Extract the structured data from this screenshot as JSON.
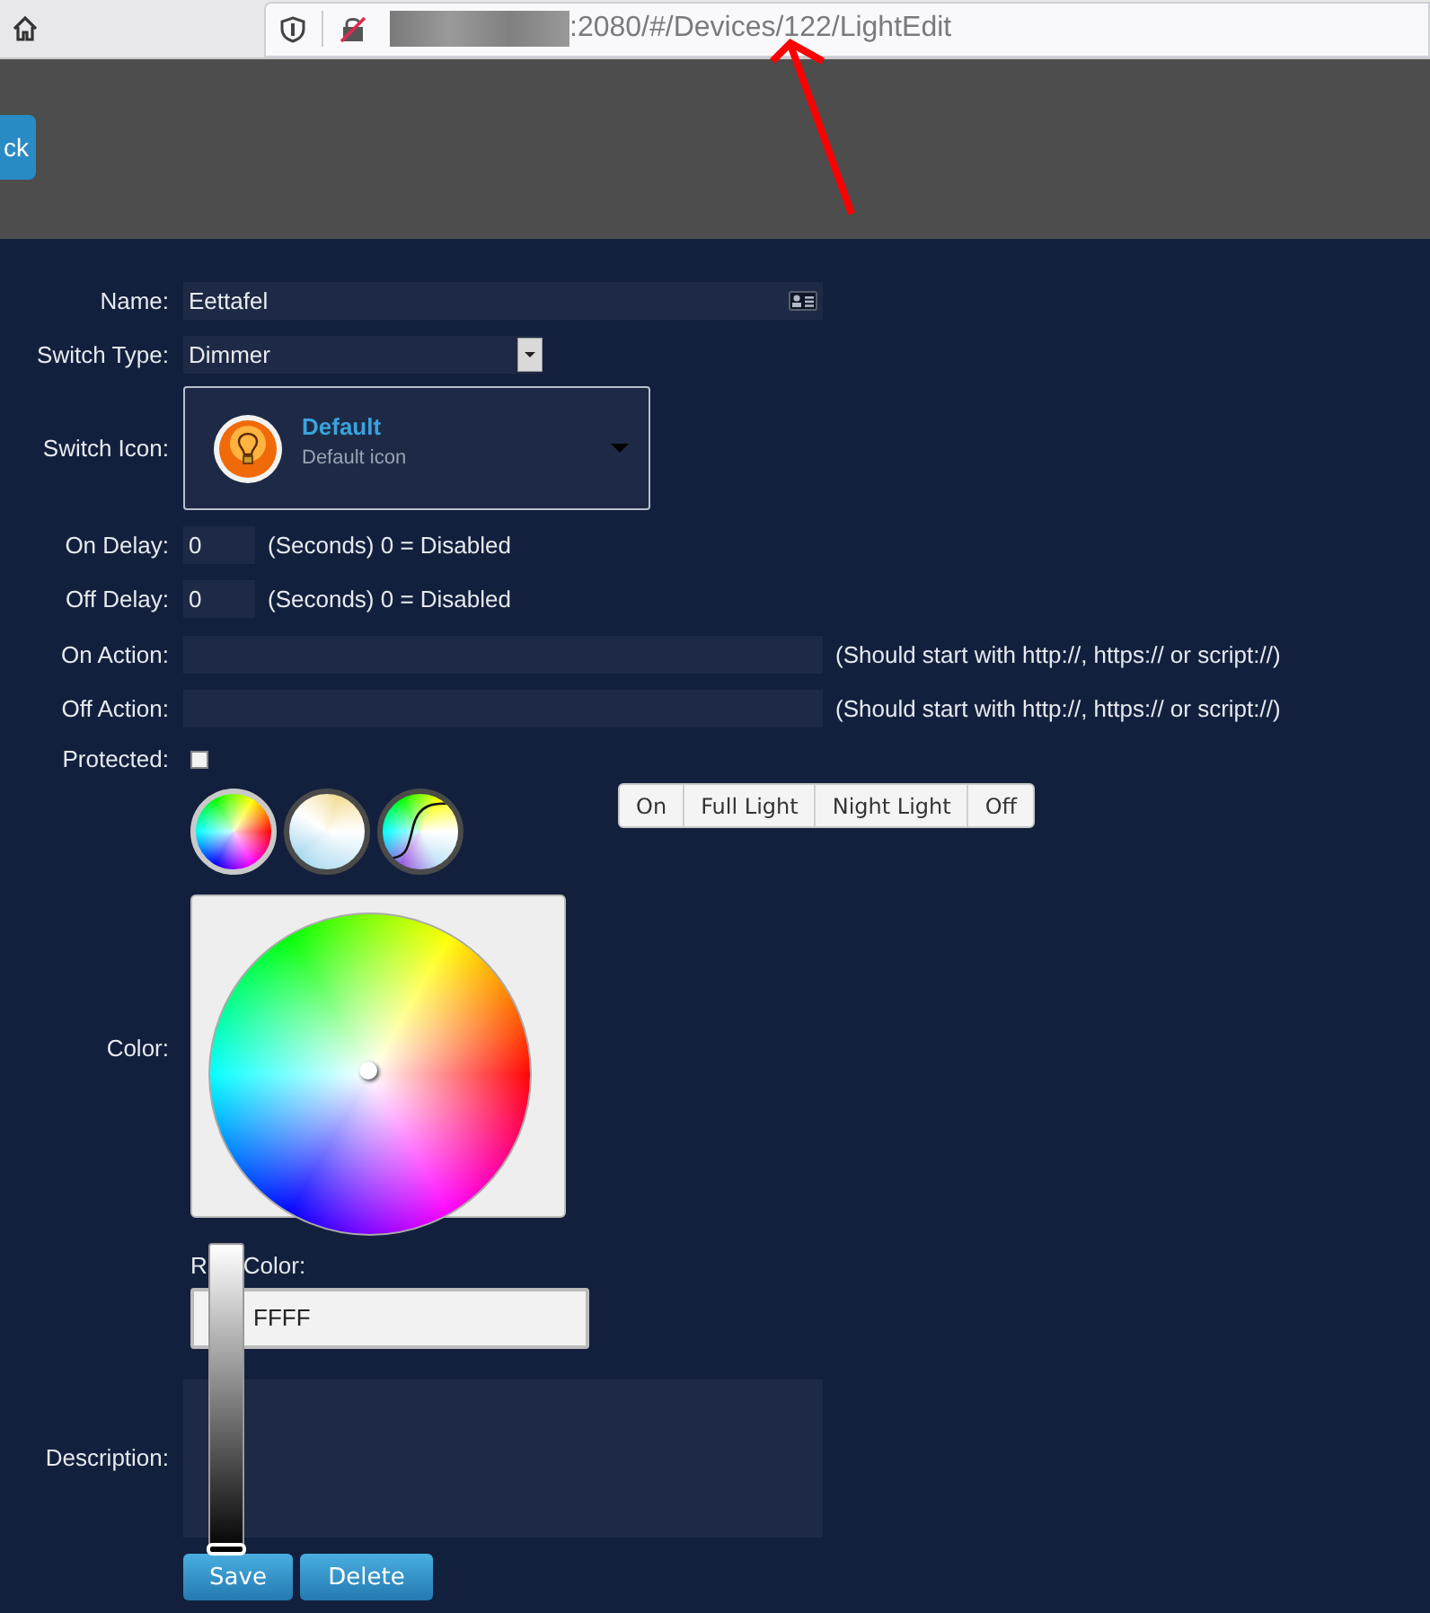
{
  "browser": {
    "url": ":2080/#/Devices/122/LightEdit"
  },
  "header": {
    "back_button": "ck"
  },
  "form": {
    "name": {
      "label": "Name:",
      "value": "Eettafel"
    },
    "switch_type": {
      "label": "Switch Type:",
      "value": "Dimmer"
    },
    "switch_icon": {
      "label": "Switch Icon:",
      "title": "Default",
      "subtitle": "Default icon"
    },
    "delays": [
      {
        "label": "On Delay:",
        "value": "0",
        "note": "(Seconds) 0 = Disabled"
      },
      {
        "label": "Off Delay:",
        "value": "0",
        "note": "(Seconds) 0 = Disabled"
      }
    ],
    "actions": [
      {
        "label": "On Action:",
        "note": "(Should start with http://, https:// or script://)"
      },
      {
        "label": "Off Action:",
        "note": "(Should start with http://, https:// or script://)"
      }
    ],
    "protected": {
      "label": "Protected:",
      "checked": false
    },
    "color_modes": [
      {
        "kind": "wheel",
        "selected": true
      },
      {
        "kind": "white",
        "selected": false
      },
      {
        "kind": "custom",
        "selected": false
      }
    ],
    "presets": [
      "On",
      "Full Light",
      "Night Light",
      "Off"
    ],
    "color": {
      "label": "Color:"
    },
    "rgb": {
      "label_parts": [
        "R",
        "Color:"
      ],
      "value": "FFFF"
    },
    "brightness": {
      "level": 0
    },
    "description": {
      "label": "Description:"
    },
    "buttons": [
      "Save",
      "Delete"
    ]
  }
}
